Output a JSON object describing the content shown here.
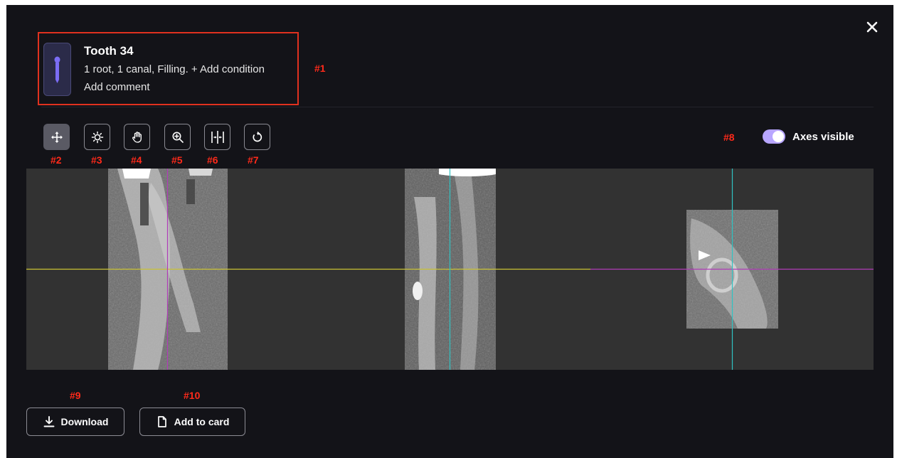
{
  "tooth": {
    "title": "Tooth 34",
    "description": "1 root, 1 canal, Filling.",
    "add_condition": "+ Add condition",
    "comment": "Add comment"
  },
  "toolbar": {
    "tools": [
      {
        "name": "move-tool",
        "icon": "move-arrows-icon",
        "active": true
      },
      {
        "name": "brightness-tool",
        "icon": "brightness-icon",
        "active": false
      },
      {
        "name": "pan-tool",
        "icon": "hand-icon",
        "active": false
      },
      {
        "name": "zoom-tool",
        "icon": "zoom-in-icon",
        "active": false
      },
      {
        "name": "measure-tool",
        "icon": "ruler-split-icon",
        "active": false
      },
      {
        "name": "reset-tool",
        "icon": "rotate-icon",
        "active": false
      }
    ],
    "axes_toggle": {
      "label": "Axes visible",
      "on": true
    }
  },
  "annotations": {
    "m1": "#1",
    "m2": "#2",
    "m3": "#3",
    "m4": "#4",
    "m5": "#5",
    "m6": "#6",
    "m7": "#7",
    "m8": "#8",
    "m9": "#9",
    "m10": "#10"
  },
  "viewer": {
    "panels": [
      "sagittal-slice",
      "coronal-slice",
      "axial-slice"
    ],
    "axis_colors": {
      "yellow": "#c9c234",
      "magenta": "#b03cb8",
      "cyan": "#2fc2c2"
    }
  },
  "actions": {
    "download": "Download",
    "add_to_card": "Add to card"
  },
  "colors": {
    "background": "#131318",
    "accent_toggle": "#b8a6ff",
    "annotation": "#ff2a1a",
    "tooth_icon": "#7b6df5"
  }
}
